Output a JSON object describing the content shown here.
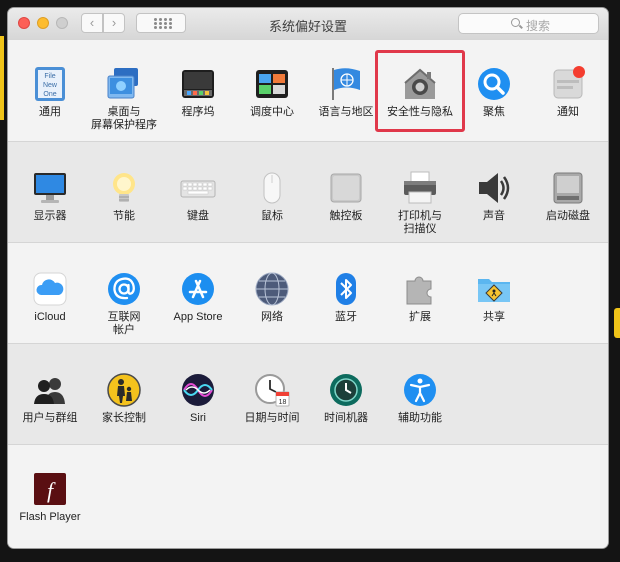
{
  "window": {
    "title": "系统偏好设置",
    "search_placeholder": "搜索",
    "back_glyph": "‹",
    "forward_glyph": "›"
  },
  "sections": [
    {
      "panes": [
        {
          "id": "general",
          "label": "通用",
          "icon": "file-new-one-icon"
        },
        {
          "id": "desktop",
          "label": "桌面与\n屏幕保护程序",
          "icon": "desktop-screensaver-icon"
        },
        {
          "id": "dock",
          "label": "程序坞",
          "icon": "dock-icon"
        },
        {
          "id": "mission",
          "label": "调度中心",
          "icon": "mission-control-icon"
        },
        {
          "id": "language",
          "label": "语言与地区",
          "icon": "flag-globe-icon"
        },
        {
          "id": "security",
          "label": "安全性与隐私",
          "icon": "house-lock-icon",
          "highlighted": true
        },
        {
          "id": "spotlight",
          "label": "聚焦",
          "icon": "magnifier-icon"
        },
        {
          "id": "notifications",
          "label": "通知",
          "icon": "notifications-icon"
        }
      ]
    },
    {
      "panes": [
        {
          "id": "displays",
          "label": "显示器",
          "icon": "monitor-icon"
        },
        {
          "id": "energy",
          "label": "节能",
          "icon": "lightbulb-icon"
        },
        {
          "id": "keyboard",
          "label": "键盘",
          "icon": "keyboard-icon"
        },
        {
          "id": "mouse",
          "label": "鼠标",
          "icon": "mouse-icon"
        },
        {
          "id": "trackpad",
          "label": "触控板",
          "icon": "trackpad-icon"
        },
        {
          "id": "printers",
          "label": "打印机与\n扫描仪",
          "icon": "printer-icon"
        },
        {
          "id": "sound",
          "label": "声音",
          "icon": "speaker-icon"
        },
        {
          "id": "startup",
          "label": "启动磁盘",
          "icon": "hard-disk-icon"
        }
      ]
    },
    {
      "panes": [
        {
          "id": "icloud",
          "label": "iCloud",
          "icon": "cloud-icon"
        },
        {
          "id": "internet",
          "label": "互联网\n帐户",
          "icon": "at-sign-icon"
        },
        {
          "id": "appstore",
          "label": "App Store",
          "icon": "app-store-icon"
        },
        {
          "id": "network",
          "label": "网络",
          "icon": "network-globe-icon"
        },
        {
          "id": "bluetooth",
          "label": "蓝牙",
          "icon": "bluetooth-icon"
        },
        {
          "id": "extensions",
          "label": "扩展",
          "icon": "puzzle-icon"
        },
        {
          "id": "sharing",
          "label": "共享",
          "icon": "shared-folder-icon"
        }
      ]
    },
    {
      "panes": [
        {
          "id": "users",
          "label": "用户与群组",
          "icon": "users-icon"
        },
        {
          "id": "parental",
          "label": "家长控制",
          "icon": "parental-controls-icon"
        },
        {
          "id": "siri",
          "label": "Siri",
          "icon": "siri-icon"
        },
        {
          "id": "datetime",
          "label": "日期与时间",
          "icon": "clock-calendar-icon"
        },
        {
          "id": "timemachine",
          "label": "时间机器",
          "icon": "time-machine-icon"
        },
        {
          "id": "accessibility",
          "label": "辅助功能",
          "icon": "accessibility-icon"
        }
      ]
    },
    {
      "panes": [
        {
          "id": "flash",
          "label": "Flash Player",
          "icon": "flash-player-icon"
        }
      ]
    }
  ],
  "icon_text": {
    "file_lines": [
      "File",
      "New",
      "One"
    ],
    "calendar_day": "18",
    "flash_glyph": "f"
  },
  "colors": {
    "highlight": "#e0384a",
    "accent_blue": "#1f8ff1"
  }
}
